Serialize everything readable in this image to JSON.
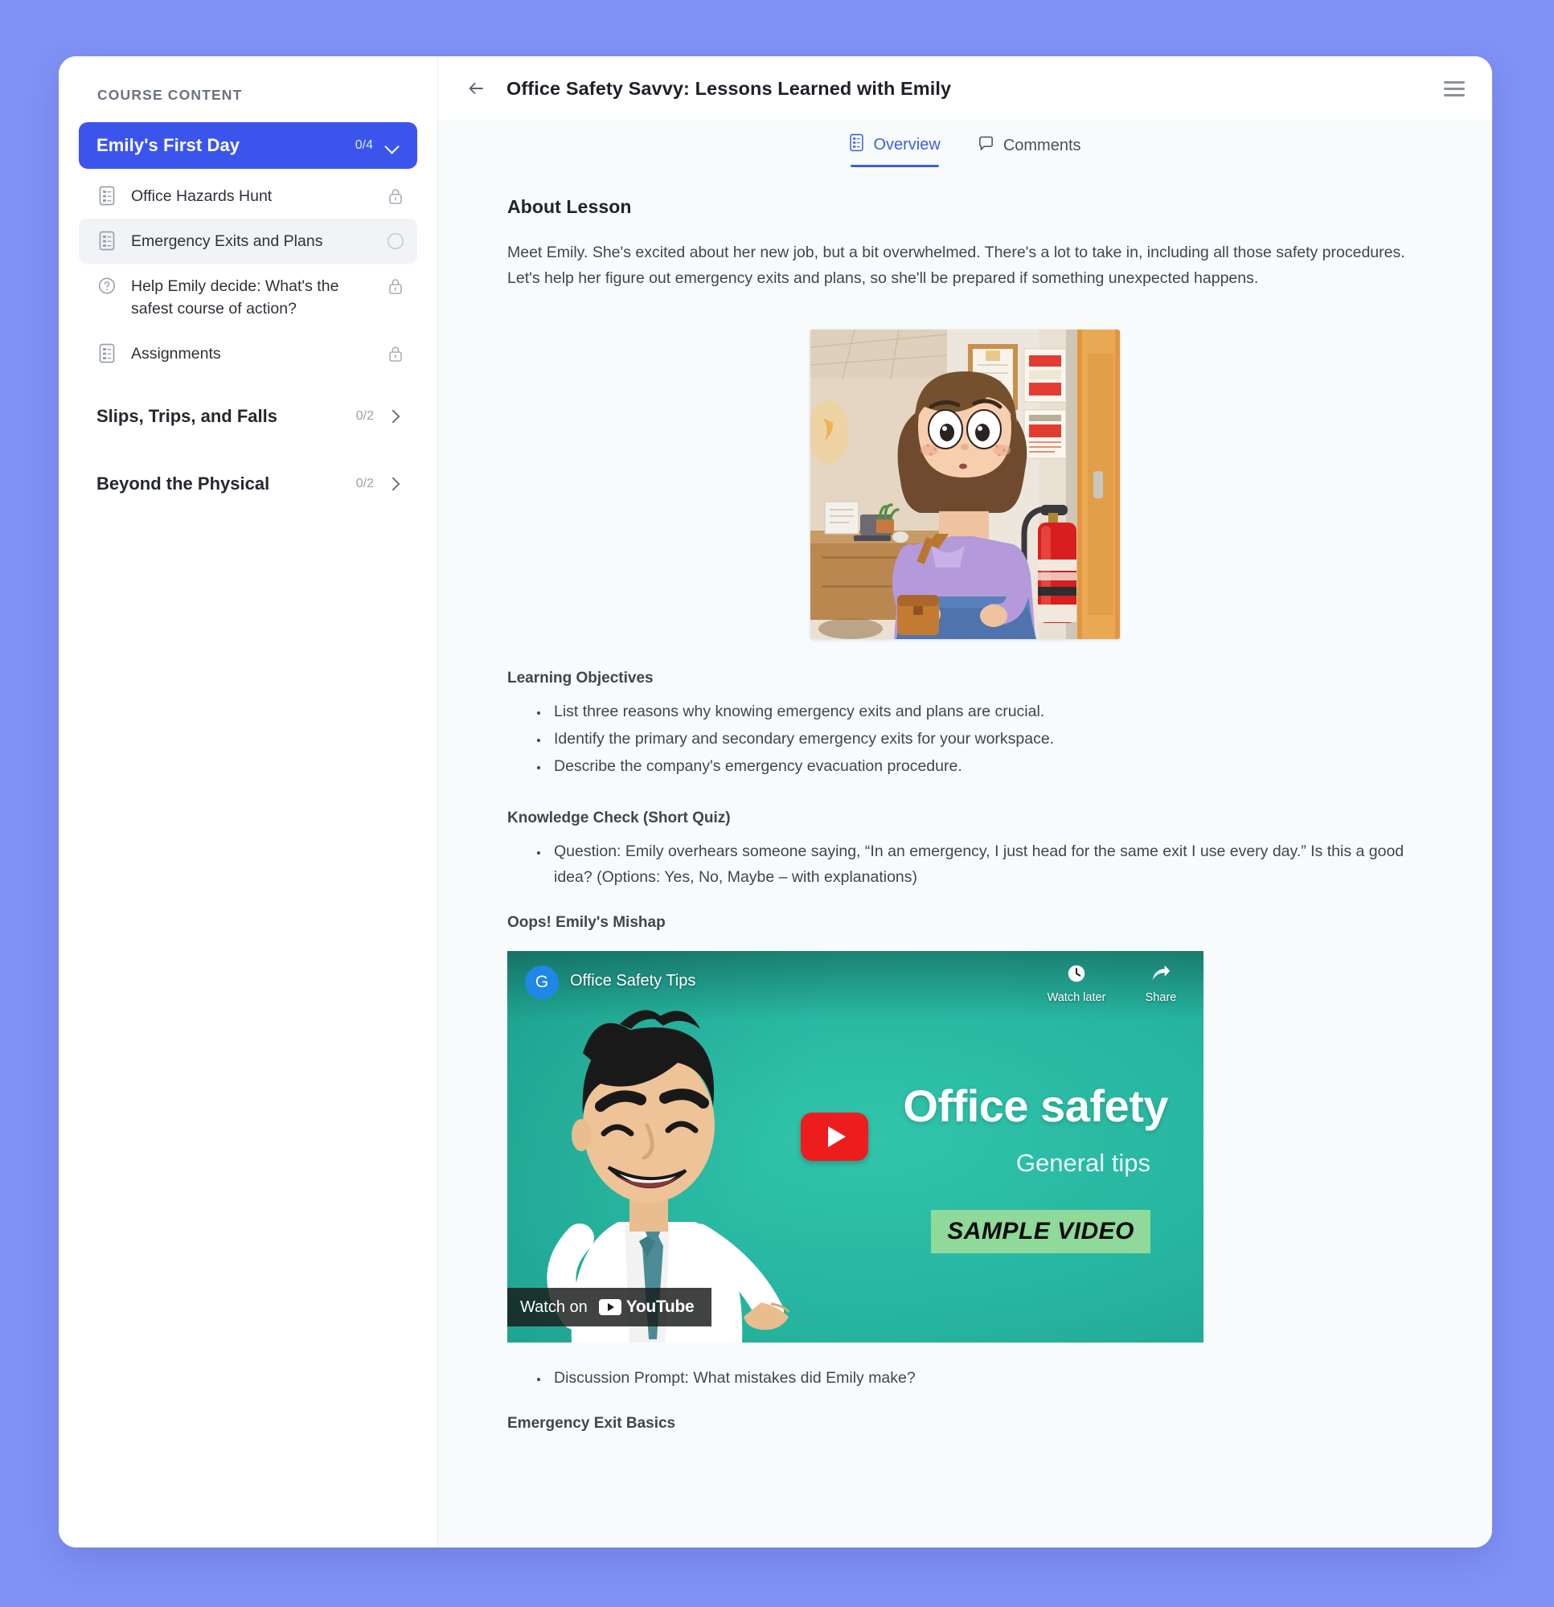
{
  "sidebar": {
    "header": "COURSE CONTENT",
    "active_section": {
      "title": "Emily's First Day",
      "count": "0/4",
      "chevron": "chevron-down-icon"
    },
    "lessons": [
      {
        "title": "Office Hazards Hunt",
        "icon": "document-icon",
        "status_icon": "lock-icon",
        "selected": false
      },
      {
        "title": "Emergency Exits and Plans",
        "icon": "document-icon",
        "status_icon": "circle-icon",
        "selected": true
      },
      {
        "title": "Help Emily decide: What's the safest course of action?",
        "icon": "question-icon",
        "status_icon": "lock-icon",
        "selected": false
      },
      {
        "title": "Assignments",
        "icon": "document-icon",
        "status_icon": "lock-icon",
        "selected": false
      }
    ],
    "sections": [
      {
        "title": "Slips, Trips, and Falls",
        "count": "0/2",
        "chevron": "chevron-right-icon"
      },
      {
        "title": "Beyond the Physical",
        "count": "0/2",
        "chevron": "chevron-right-icon"
      }
    ]
  },
  "header": {
    "back_icon": "arrow-left-icon",
    "title": "Office Safety Savvy: Lessons Learned with Emily",
    "menu_icon": "hamburger-menu-icon"
  },
  "tabs": [
    {
      "label": "Overview",
      "icon": "document-icon",
      "active": true
    },
    {
      "label": "Comments",
      "icon": "comment-icon",
      "active": false
    }
  ],
  "content": {
    "about_heading": "About Lesson",
    "intro": "Meet Emily. She's excited about her new job, but a bit overwhelmed. There's a lot to take in, including all those safety procedures. Let's help her figure out emergency exits and plans, so she'll be prepared if something unexpected happens.",
    "hero_alt": "Cartoon illustration of Emily standing in an office hallway beside a red fire extinguisher",
    "objectives_heading": "Learning Objectives",
    "objectives": [
      "List three reasons why knowing emergency exits and plans are crucial.",
      "Identify the primary and secondary emergency exits for your workspace.",
      "Describe the company's emergency evacuation procedure."
    ],
    "quiz_heading": "Knowledge Check (Short Quiz)",
    "quiz_items": [
      "Question: Emily overhears someone saying, “In an emergency, I just head for the same exit I use every day.” Is this a good idea? (Options: Yes, No, Maybe – with explanations)"
    ],
    "mishap_heading": "Oops! Emily's Mishap",
    "discussion_items": [
      "Discussion Prompt: What mistakes did Emily make?"
    ],
    "basics_heading": "Emergency Exit Basics"
  },
  "video": {
    "channel_initial": "G",
    "title": "Office Safety Tips",
    "watch_later": "Watch later",
    "share": "Share",
    "headline": "Office safety",
    "subhead": "General tips",
    "sample_badge": "SAMPLE VIDEO",
    "watch_on_label": "Watch on",
    "platform": "YouTube",
    "play_icon": "youtube-play-icon"
  },
  "colors": {
    "page_background": "#8092f6",
    "accent_blue": "#3b55ec",
    "tab_active": "#3f5fd6",
    "content_background": "#f8fbfb",
    "video_teal": "#26b4a0",
    "youtube_red": "#ee1d1d"
  }
}
